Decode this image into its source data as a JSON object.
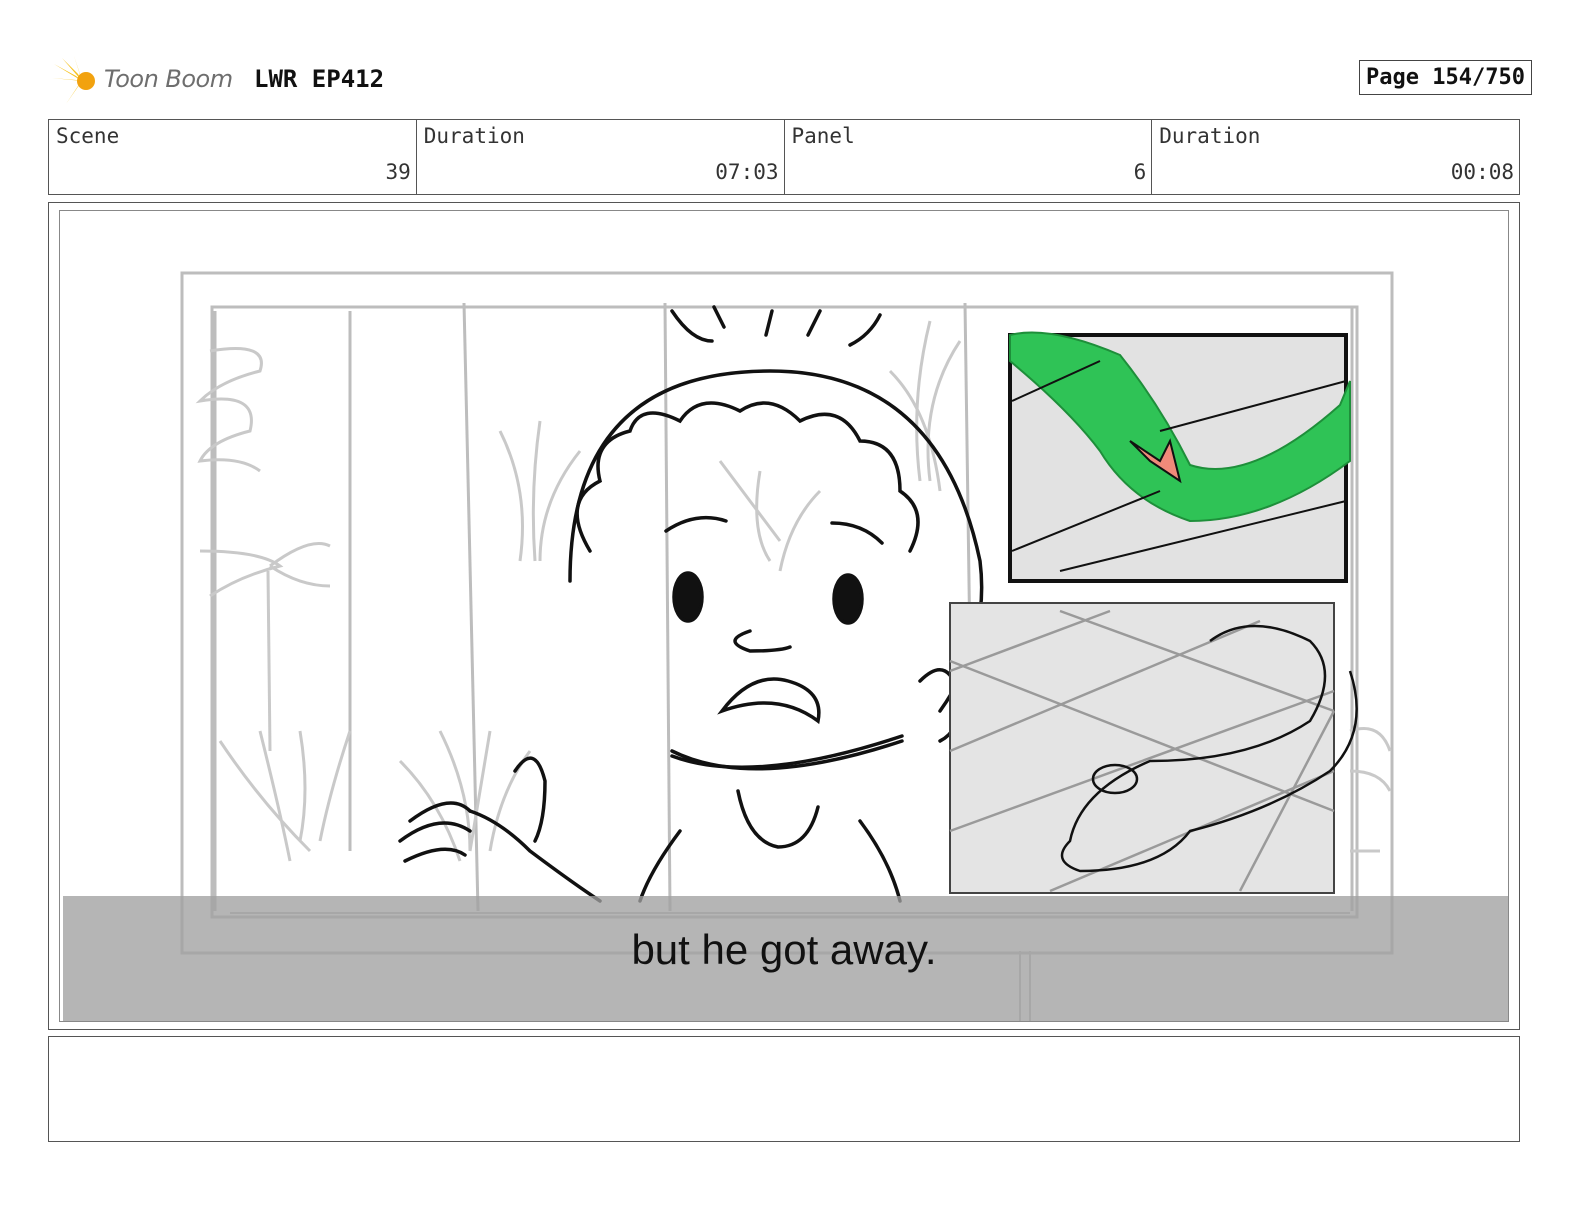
{
  "header": {
    "logo_text": "Toon Boom",
    "project": "LWR EP412",
    "page_label": "Page 154/750"
  },
  "info": [
    {
      "label": "Scene",
      "value": "39"
    },
    {
      "label": "Duration",
      "value": "07:03"
    },
    {
      "label": "Panel",
      "value": "6"
    },
    {
      "label": "Duration",
      "value": "00:08"
    }
  ],
  "panel": {
    "subtitle": "but he got away.",
    "accent_green": "#2fc356",
    "accent_pink": "#f08a7a"
  },
  "notes": {
    "text": ""
  }
}
